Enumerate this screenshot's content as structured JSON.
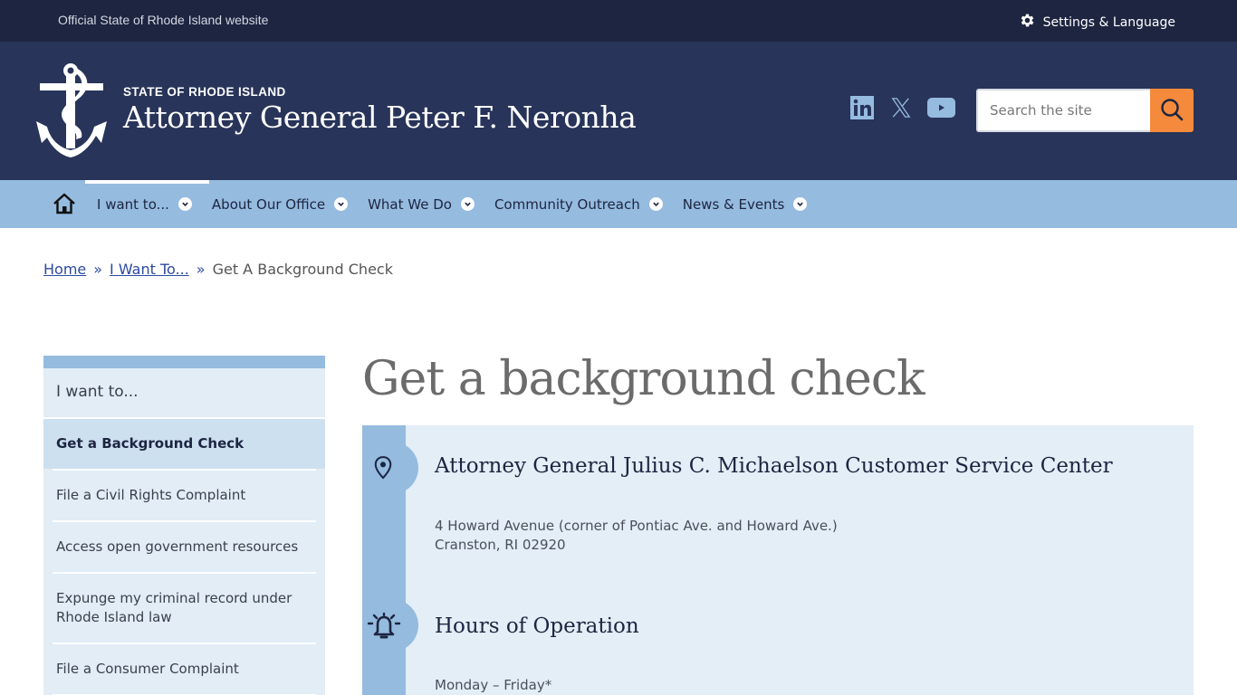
{
  "utility_bar": {
    "official_text": "Official State of Rhode Island website",
    "settings_label": "Settings & Language"
  },
  "header": {
    "state_label": "STATE OF RHODE ISLAND",
    "site_title": "Attorney General Peter F. Neronha",
    "social": [
      {
        "name": "linkedin",
        "icon": "linkedin-icon"
      },
      {
        "name": "x",
        "icon": "x-icon"
      },
      {
        "name": "youtube",
        "icon": "youtube-icon"
      }
    ],
    "search": {
      "placeholder": "Search the site",
      "value": ""
    }
  },
  "nav": {
    "items": [
      {
        "label": "I want to...",
        "active": true
      },
      {
        "label": "About Our Office"
      },
      {
        "label": "What We Do"
      },
      {
        "label": "Community Outreach"
      },
      {
        "label": "News & Events"
      }
    ]
  },
  "breadcrumb": {
    "items": [
      "Home",
      "I Want To...",
      "Get A Background Check"
    ],
    "separator": "»"
  },
  "sidebar": {
    "heading": "I want to...",
    "items": [
      {
        "label": "Get a Background Check",
        "active": true
      },
      {
        "label": "File a Civil Rights Complaint"
      },
      {
        "label": "Access open government resources"
      },
      {
        "label": "Expunge my criminal record under Rhode Island law"
      },
      {
        "label": "File a Consumer Complaint"
      }
    ]
  },
  "main": {
    "title": "Get a background check",
    "sections": [
      {
        "icon": "map-pin-icon",
        "title": "Attorney General Julius C. Michaelson Customer Service Center",
        "lines": [
          "4 Howard Avenue (corner of Pontiac Ave. and Howard Ave.)",
          "Cranston, RI 02920"
        ]
      },
      {
        "icon": "bell-icon",
        "title": "Hours of Operation",
        "lines": [
          "Monday – Friday*"
        ]
      }
    ]
  },
  "colors": {
    "utility_bg": "#1d2540",
    "header_bg": "#283459",
    "nav_bg": "#95bbdf",
    "accent_orange": "#f58a3c",
    "card_bg": "#e3eef7",
    "link": "#2b4aa0"
  }
}
